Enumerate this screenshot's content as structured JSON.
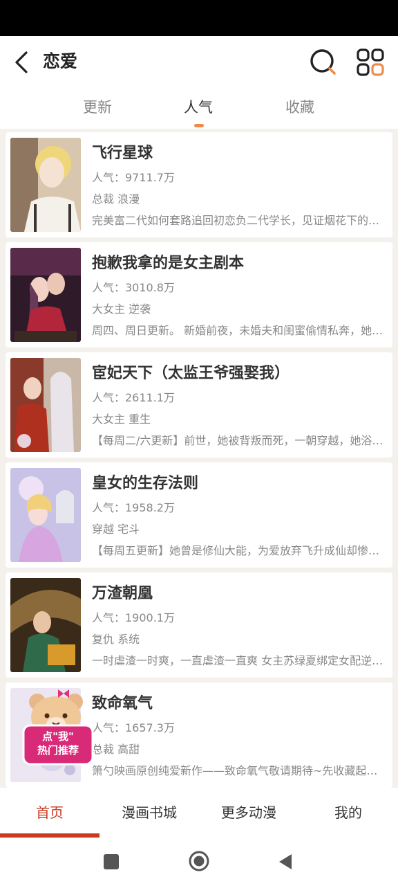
{
  "header": {
    "title": "恋爱",
    "tabs": [
      {
        "label": "更新",
        "active": false
      },
      {
        "label": "人气",
        "active": true
      },
      {
        "label": "收藏",
        "active": false
      }
    ]
  },
  "comics": [
    {
      "title": "飞行星球",
      "popularity": "人气：9711.7万",
      "tags": "总裁 浪漫",
      "desc": "完美富二代如何套路追回初恋负二代学长，见证烟花下的爱情奇迹"
    },
    {
      "title": "抱歉我拿的是女主剧本",
      "popularity": "人气：3010.8万",
      "tags": "大女主 逆袭",
      "desc": "周四、周日更新。 新婚前夜，未婚夫和闺蜜偷情私奔，她被迫嫁人"
    },
    {
      "title": "宦妃天下（太监王爷强娶我）",
      "popularity": "人气：2611.1万",
      "tags": "大女主 重生",
      "desc": "【每周二/六更新】前世，她被背叛而死，一朝穿越，她浴火重生"
    },
    {
      "title": "皇女的生存法则",
      "popularity": "人气：1958.2万",
      "tags": "穿越 宅斗",
      "desc": "【每周五更新】她曾是修仙大能，为爱放弃飞升成仙却惨遭背叛"
    },
    {
      "title": "万渣朝凰",
      "popularity": "人气：1900.1万",
      "tags": "复仇 系统",
      "desc": "一时虐渣一时爽，一直虐渣一直爽 女主苏绿夏绑定女配逆袭系统"
    },
    {
      "title": "致命氧气",
      "popularity": "人气：1657.3万",
      "tags": "总裁 高甜",
      "desc": "箫勺映画原创纯爱新作——致命氧气敬请期待~先收藏起来吧"
    }
  ],
  "sticker": {
    "line1": "点\"我\"",
    "line2": "热门推荐"
  },
  "bottom_nav": [
    {
      "label": "首页",
      "active": true
    },
    {
      "label": "漫画书城",
      "active": false
    },
    {
      "label": "更多动漫",
      "active": false
    },
    {
      "label": "我的",
      "active": false
    }
  ],
  "colors": {
    "accent": "#f08a4b",
    "nav_active": "#c93a1e"
  },
  "icons": [
    "back-arrow-icon",
    "search-icon",
    "grid-menu-icon",
    "stop-square-icon",
    "home-circle-icon",
    "back-triangle-icon"
  ]
}
